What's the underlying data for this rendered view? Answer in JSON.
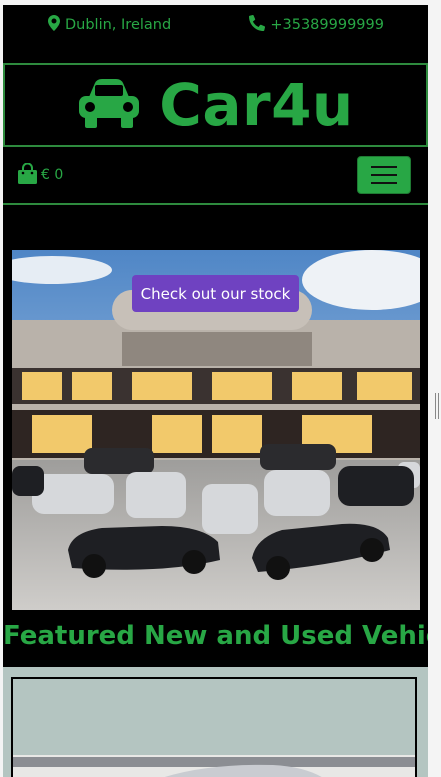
{
  "topbar": {
    "location": "Dublin, Ireland",
    "phone": "+35389999999",
    "location_icon": "map-marker-icon",
    "phone_icon": "phone-icon"
  },
  "brand": {
    "name": "Car4u",
    "icon": "car-icon"
  },
  "nav": {
    "cart_amount": "€ 0",
    "cart_icon": "shopping-bag-icon",
    "menu_icon": "hamburger-icon"
  },
  "hero": {
    "cta_label": "Check out our stock",
    "image": "car-dealership-photo"
  },
  "featured": {
    "heading": "Featured New and Used Vehicles"
  },
  "colors": {
    "accent": "#28a745",
    "cta": "#6f42c1",
    "background": "#000000",
    "card_bg": "#b4c5c1"
  }
}
